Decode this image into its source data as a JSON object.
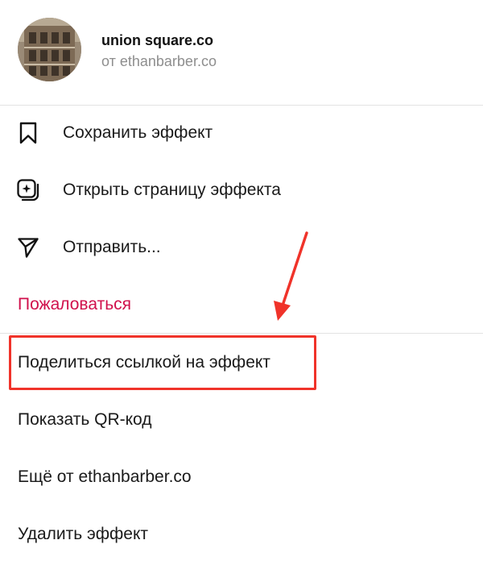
{
  "header": {
    "effect_name": "union square.co",
    "author_line": "от ethanbarber.co"
  },
  "menu": {
    "save": "Сохранить эффект",
    "open_page": "Открыть страницу эффекта",
    "send": "Отправить...",
    "report": "Пожаловаться",
    "share_link": "Поделиться ссылкой на эффект",
    "show_qr": "Показать QR-код",
    "more_from": "Ещё от ethanbarber.co",
    "delete": "Удалить эффект"
  },
  "icons": {
    "save": "bookmark-icon",
    "open_page": "effect-page-icon",
    "send": "paper-plane-icon"
  },
  "colors": {
    "report": "#d0104c",
    "highlight": "#f0332a"
  }
}
